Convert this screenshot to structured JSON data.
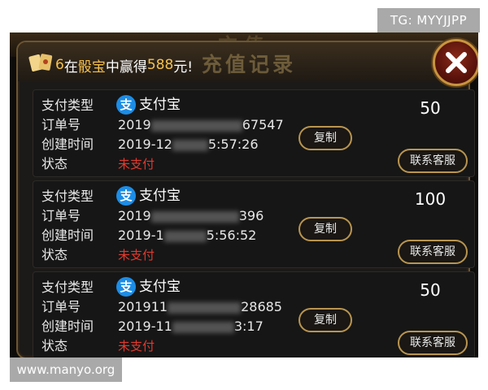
{
  "watermarks": {
    "top": "TG: MYYJJPP",
    "bottom": "www.manyo.org"
  },
  "background_title": "充值",
  "panel": {
    "title": "充值记录",
    "marquee": {
      "name_part": "6",
      "text1": "在",
      "game": "骰宝",
      "text2": "中赢得",
      "amount": "588",
      "text3": "元!"
    }
  },
  "labels": {
    "pay_type": "支付类型",
    "order_no": "订单号",
    "created": "创建时间",
    "status": "状态",
    "copy": "复制",
    "service": "联系客服"
  },
  "records": [
    {
      "pay_method": "支付宝",
      "order_prefix": "2019",
      "order_suffix": "67547",
      "created_prefix": "2019-12",
      "created_suffix": "5:57:26",
      "status": "未支付",
      "amount": "50"
    },
    {
      "pay_method": "支付宝",
      "order_prefix": "2019",
      "order_suffix": "396",
      "created_prefix": "2019-1",
      "created_suffix": "5:56:52",
      "status": "未支付",
      "amount": "100"
    },
    {
      "pay_method": "支付宝",
      "order_prefix": "201911",
      "order_suffix": "28685",
      "created_prefix": "2019-11",
      "created_suffix": "3:17",
      "status": "未支付",
      "amount": "50"
    }
  ],
  "colors": {
    "status_unpaid": "#e23a2e",
    "accent_gold": "#f5c04d",
    "alipay_blue": "#1c8de6"
  }
}
